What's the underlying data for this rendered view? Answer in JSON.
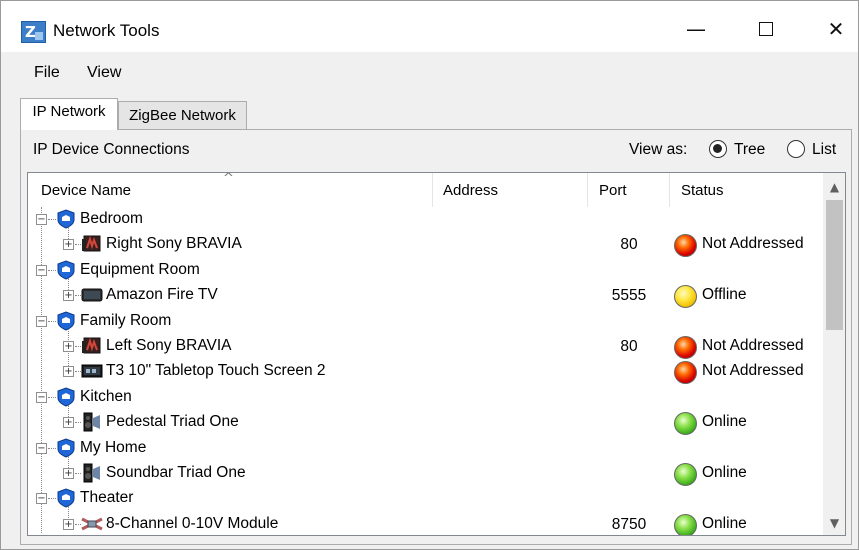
{
  "window": {
    "title": "Network Tools",
    "app_icon": "zeta-app-icon",
    "controls": {
      "minimize": "—",
      "close": "✕"
    }
  },
  "menu": {
    "file": "File",
    "view": "View"
  },
  "tabs": [
    {
      "label": "IP Network",
      "active": true
    },
    {
      "label": "ZigBee Network",
      "active": false
    }
  ],
  "panel": {
    "title": "IP Device Connections",
    "view_as_label": "View as:",
    "view_options": [
      {
        "label": "Tree",
        "selected": true
      },
      {
        "label": "List",
        "selected": false
      }
    ]
  },
  "table": {
    "columns": [
      "Device Name",
      "Address",
      "Port",
      "Status"
    ],
    "sort_indicator": "^",
    "rows": [
      {
        "type": "room",
        "name": "Bedroom",
        "port": "",
        "status": ""
      },
      {
        "type": "device",
        "icon": "tv-icon",
        "name": "Right Sony BRAVIA",
        "port": "80",
        "status": "Not Addressed",
        "status_color": "red"
      },
      {
        "type": "room",
        "name": "Equipment Room",
        "port": "",
        "status": ""
      },
      {
        "type": "device",
        "icon": "streaming-box-icon",
        "name": "Amazon Fire TV",
        "port": "5555",
        "status": "Offline",
        "status_color": "yellow"
      },
      {
        "type": "room",
        "name": "Family Room",
        "port": "",
        "status": ""
      },
      {
        "type": "device",
        "icon": "tv-icon",
        "name": "Left Sony BRAVIA",
        "port": "80",
        "status": "Not Addressed",
        "status_color": "red"
      },
      {
        "type": "device",
        "icon": "touch-screen-icon",
        "name": "T3 10\" Tabletop Touch Screen 2",
        "port": "",
        "status": "Not Addressed",
        "status_color": "red"
      },
      {
        "type": "room",
        "name": "Kitchen",
        "port": "",
        "status": ""
      },
      {
        "type": "device",
        "icon": "speaker-icon",
        "name": "Pedestal Triad One",
        "port": "",
        "status": "Online",
        "status_color": "green"
      },
      {
        "type": "room",
        "name": "My Home",
        "port": "",
        "status": ""
      },
      {
        "type": "device",
        "icon": "speaker-icon",
        "name": "Soundbar Triad One",
        "port": "",
        "status": "Online",
        "status_color": "green"
      },
      {
        "type": "room",
        "name": "Theater",
        "port": "",
        "status": ""
      },
      {
        "type": "device",
        "icon": "relay-module-icon",
        "name": "8-Channel 0-10V Module",
        "port": "8750",
        "status": "Online",
        "status_color": "green"
      }
    ]
  },
  "colors": {
    "status_red": "#d80000",
    "status_yellow": "#f2c200",
    "status_green": "#3fb11d",
    "room_icon_blue": "#1f66d6"
  }
}
